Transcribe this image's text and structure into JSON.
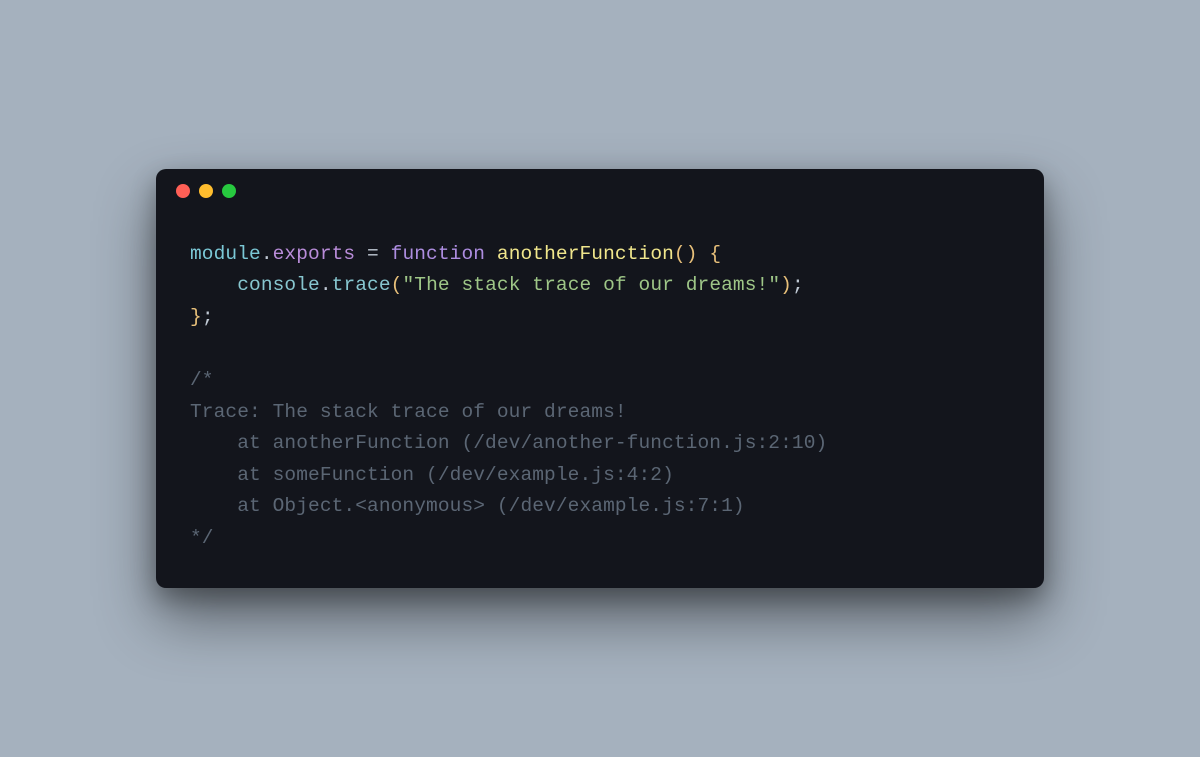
{
  "code": {
    "line1": {
      "module": "module",
      "dot1": ".",
      "exports": "exports",
      "sp_eq": " = ",
      "keyword": "function",
      "sp1": " ",
      "funcname": "anotherFunction",
      "paren_open": "(",
      "paren_close": ")",
      "sp2": " ",
      "brace_open": "{"
    },
    "line2": {
      "indent": "    ",
      "console": "console",
      "dot": ".",
      "method": "trace",
      "paren_open": "(",
      "string": "\"The stack trace of our dreams!\"",
      "paren_close": ")",
      "semi": ";"
    },
    "line3": {
      "brace_close": "}",
      "semi": ";"
    },
    "comment": {
      "l1": "/*",
      "l2": "Trace: The stack trace of our dreams!",
      "l3": "    at anotherFunction (/dev/another-function.js:2:10)",
      "l4": "    at someFunction (/dev/example.js:4:2)",
      "l5": "    at Object.<anonymous> (/dev/example.js:7:1)",
      "l6": "*/"
    }
  }
}
